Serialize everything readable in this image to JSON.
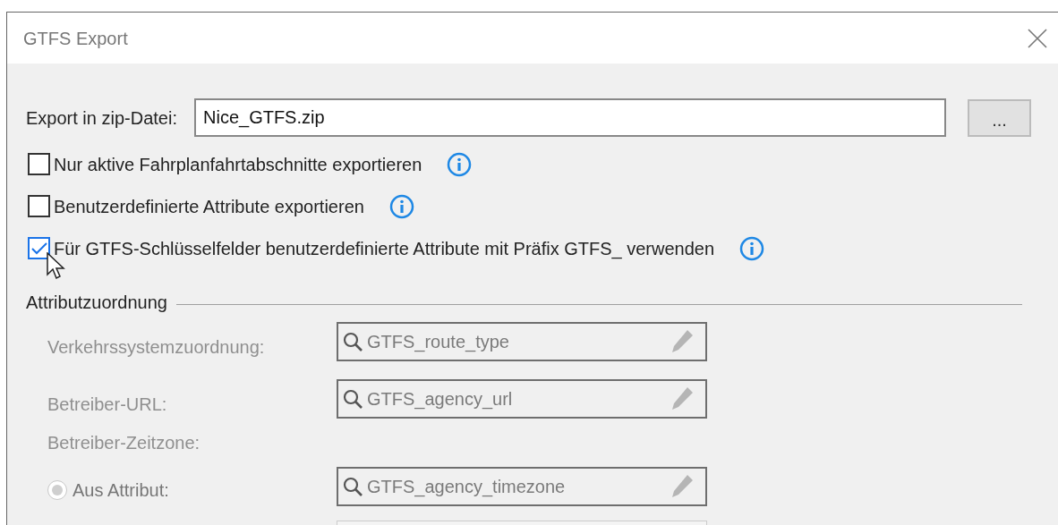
{
  "window": {
    "title": "GTFS Export"
  },
  "export_file": {
    "label": "Export in zip-Datei:",
    "value": "Nice_GTFS.zip",
    "browse_button": "..."
  },
  "options": [
    {
      "label": "Nur aktive Fahrplanfahrtabschnitte exportieren",
      "checked": false
    },
    {
      "label": "Benutzerdefinierte Attribute exportieren",
      "checked": false
    },
    {
      "label": "Für GTFS-Schlüsselfelder benutzerdefinierte Attribute mit Präfix GTFS_ verwenden",
      "checked": true
    }
  ],
  "attribute_mapping": {
    "title": "Attributzuordnung",
    "disabled": true,
    "rows": [
      {
        "kind": "field",
        "label": "Verkehrssystemzuordnung:",
        "value": "GTFS_route_type"
      },
      {
        "kind": "field",
        "label": "Betreiber-URL:",
        "value": "GTFS_agency_url"
      },
      {
        "kind": "heading",
        "label": "Betreiber-Zeitzone:"
      },
      {
        "kind": "radio",
        "label": "Aus Attribut:",
        "selected": true,
        "value": "GTFS_agency_timezone"
      },
      {
        "kind": "partial"
      }
    ]
  }
}
